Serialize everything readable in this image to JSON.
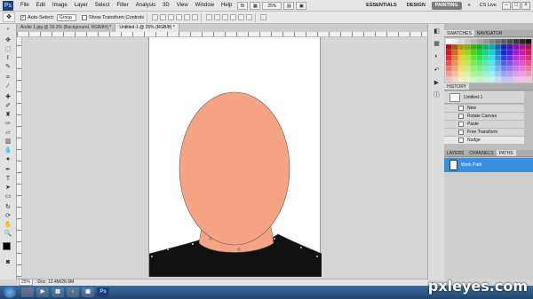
{
  "app": {
    "logo": "Ps"
  },
  "menu": [
    "File",
    "Edit",
    "Image",
    "Layer",
    "Select",
    "Filter",
    "Analysis",
    "3D",
    "View",
    "Window",
    "Help"
  ],
  "zoom": "25%",
  "workspaces": [
    "ESSENTIALS",
    "DESIGN",
    "PAINTING"
  ],
  "cs_live": "CS Live",
  "options": {
    "auto_select_label": "Auto-Select:",
    "auto_select_value": "Group",
    "transform_label": "Show Transform Controls"
  },
  "doc_tabs": [
    "Andie 1.jpg @ 33.3% (Background, RGB/8#) *",
    "Untitled-1 @ 25% (RGB/8) *"
  ],
  "status": {
    "zoom": "25%",
    "doc": "Doc: 12.4M/26.6M"
  },
  "panels": {
    "swatches_tabs": [
      "SWATCHES",
      "NAVIGATOR"
    ],
    "history_tab": "HISTORY",
    "history_snapshot": "Untitled-1",
    "history_items": [
      "New",
      "Rotate Canvas",
      "Paste",
      "Free Transform",
      "Nudge"
    ],
    "layers_tabs": [
      "LAYERS",
      "CHANNELS",
      "PATHS"
    ],
    "path_name": "Work Path"
  },
  "watermark": "pxleyes.com",
  "colors": {
    "face": "#f7a484",
    "shirt": "#111111",
    "accent": "#3a8fe0"
  }
}
